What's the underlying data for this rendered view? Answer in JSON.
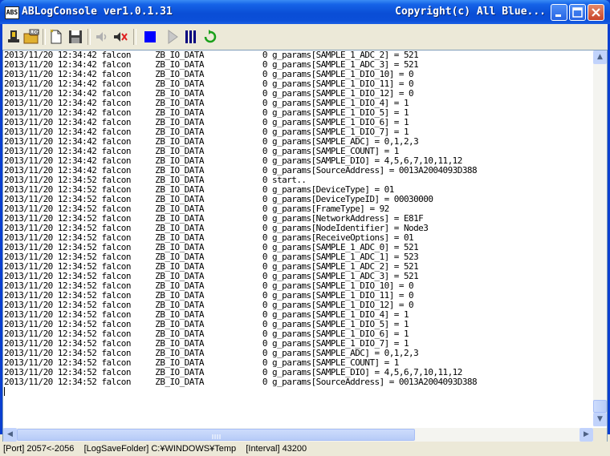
{
  "window": {
    "title": "ABLogConsole ver1.0.1.31",
    "copyright": "Copyright(c) All Blue...",
    "icon_text": "ABS"
  },
  "toolbar": {
    "tools": [
      {
        "name": "connect-icon"
      },
      {
        "name": "log-folder-icon"
      },
      {
        "name": "new-icon"
      },
      {
        "name": "save-icon"
      },
      {
        "name": "sound-on-icon"
      },
      {
        "name": "sound-off-icon"
      },
      {
        "name": "stop-icon"
      },
      {
        "name": "play-icon"
      },
      {
        "name": "pause-icon"
      },
      {
        "name": "refresh-icon"
      }
    ]
  },
  "log": {
    "lines": [
      "2013/11/20 12:34:42 falcon     ZB_IO_DATA            0 g_params[SAMPLE_1_ADC_2] = 521",
      "2013/11/20 12:34:42 falcon     ZB_IO_DATA            0 g_params[SAMPLE_1_ADC_3] = 521",
      "2013/11/20 12:34:42 falcon     ZB_IO_DATA            0 g_params[SAMPLE_1_DIO_10] = 0",
      "2013/11/20 12:34:42 falcon     ZB_IO_DATA            0 g_params[SAMPLE_1_DIO_11] = 0",
      "2013/11/20 12:34:42 falcon     ZB_IO_DATA            0 g_params[SAMPLE_1_DIO_12] = 0",
      "2013/11/20 12:34:42 falcon     ZB_IO_DATA            0 g_params[SAMPLE_1_DIO_4] = 1",
      "2013/11/20 12:34:42 falcon     ZB_IO_DATA            0 g_params[SAMPLE_1_DIO_5] = 1",
      "2013/11/20 12:34:42 falcon     ZB_IO_DATA            0 g_params[SAMPLE_1_DIO_6] = 1",
      "2013/11/20 12:34:42 falcon     ZB_IO_DATA            0 g_params[SAMPLE_1_DIO_7] = 1",
      "2013/11/20 12:34:42 falcon     ZB_IO_DATA            0 g_params[SAMPLE_ADC] = 0,1,2,3",
      "2013/11/20 12:34:42 falcon     ZB_IO_DATA            0 g_params[SAMPLE_COUNT] = 1",
      "2013/11/20 12:34:42 falcon     ZB_IO_DATA            0 g_params[SAMPLE_DIO] = 4,5,6,7,10,11,12",
      "2013/11/20 12:34:42 falcon     ZB_IO_DATA            0 g_params[SourceAddress] = 0013A2004093D388",
      "2013/11/20 12:34:52 falcon     ZB_IO_DATA            0 start..",
      "2013/11/20 12:34:52 falcon     ZB_IO_DATA            0 g_params[DeviceType] = 01",
      "2013/11/20 12:34:52 falcon     ZB_IO_DATA            0 g_params[DeviceTypeID] = 00030000",
      "2013/11/20 12:34:52 falcon     ZB_IO_DATA            0 g_params[FrameType] = 92",
      "2013/11/20 12:34:52 falcon     ZB_IO_DATA            0 g_params[NetworkAddress] = E81F",
      "2013/11/20 12:34:52 falcon     ZB_IO_DATA            0 g_params[NodeIdentifier] = Node3",
      "2013/11/20 12:34:52 falcon     ZB_IO_DATA            0 g_params[ReceiveOptions] = 01",
      "2013/11/20 12:34:52 falcon     ZB_IO_DATA            0 g_params[SAMPLE_1_ADC_0] = 521",
      "2013/11/20 12:34:52 falcon     ZB_IO_DATA            0 g_params[SAMPLE_1_ADC_1] = 523",
      "2013/11/20 12:34:52 falcon     ZB_IO_DATA            0 g_params[SAMPLE_1_ADC_2] = 521",
      "2013/11/20 12:34:52 falcon     ZB_IO_DATA            0 g_params[SAMPLE_1_ADC_3] = 521",
      "2013/11/20 12:34:52 falcon     ZB_IO_DATA            0 g_params[SAMPLE_1_DIO_10] = 0",
      "2013/11/20 12:34:52 falcon     ZB_IO_DATA            0 g_params[SAMPLE_1_DIO_11] = 0",
      "2013/11/20 12:34:52 falcon     ZB_IO_DATA            0 g_params[SAMPLE_1_DIO_12] = 0",
      "2013/11/20 12:34:52 falcon     ZB_IO_DATA            0 g_params[SAMPLE_1_DIO_4] = 1",
      "2013/11/20 12:34:52 falcon     ZB_IO_DATA            0 g_params[SAMPLE_1_DIO_5] = 1",
      "2013/11/20 12:34:52 falcon     ZB_IO_DATA            0 g_params[SAMPLE_1_DIO_6] = 1",
      "2013/11/20 12:34:52 falcon     ZB_IO_DATA            0 g_params[SAMPLE_1_DIO_7] = 1",
      "2013/11/20 12:34:52 falcon     ZB_IO_DATA            0 g_params[SAMPLE_ADC] = 0,1,2,3",
      "2013/11/20 12:34:52 falcon     ZB_IO_DATA            0 g_params[SAMPLE_COUNT] = 1",
      "2013/11/20 12:34:52 falcon     ZB_IO_DATA            0 g_params[SAMPLE_DIO] = 4,5,6,7,10,11,12",
      "2013/11/20 12:34:52 falcon     ZB_IO_DATA            0 g_params[SourceAddress] = 0013A2004093D388"
    ]
  },
  "scrollbars": {
    "up_arrow": "▲",
    "down_arrow": "▼",
    "left_arrow": "◀",
    "right_arrow": "▶"
  },
  "status": {
    "text": "[Port] 2057<-2056    [LogSaveFolder] C:¥WINDOWS¥Temp    [Interval] 43200"
  },
  "colors": {
    "titlebar": "#0b4fd8",
    "stop": "#0000ff",
    "pause": "#000080",
    "refresh": "#1aa01a"
  }
}
